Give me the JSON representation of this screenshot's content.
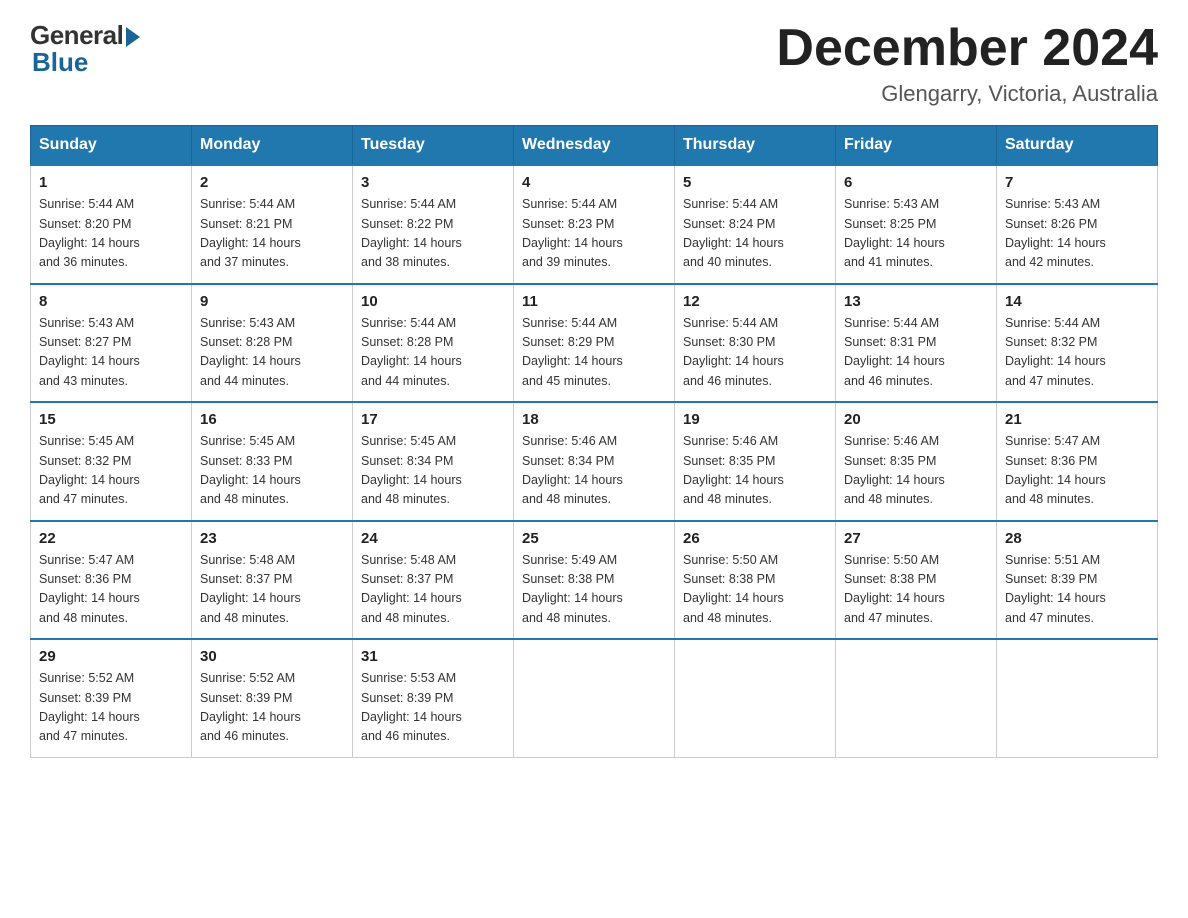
{
  "header": {
    "logo_general": "General",
    "logo_blue": "Blue",
    "month_title": "December 2024",
    "location": "Glengarry, Victoria, Australia"
  },
  "days_of_week": [
    "Sunday",
    "Monday",
    "Tuesday",
    "Wednesday",
    "Thursday",
    "Friday",
    "Saturday"
  ],
  "weeks": [
    [
      {
        "num": "1",
        "sunrise": "5:44 AM",
        "sunset": "8:20 PM",
        "daylight": "14 hours and 36 minutes."
      },
      {
        "num": "2",
        "sunrise": "5:44 AM",
        "sunset": "8:21 PM",
        "daylight": "14 hours and 37 minutes."
      },
      {
        "num": "3",
        "sunrise": "5:44 AM",
        "sunset": "8:22 PM",
        "daylight": "14 hours and 38 minutes."
      },
      {
        "num": "4",
        "sunrise": "5:44 AM",
        "sunset": "8:23 PM",
        "daylight": "14 hours and 39 minutes."
      },
      {
        "num": "5",
        "sunrise": "5:44 AM",
        "sunset": "8:24 PM",
        "daylight": "14 hours and 40 minutes."
      },
      {
        "num": "6",
        "sunrise": "5:43 AM",
        "sunset": "8:25 PM",
        "daylight": "14 hours and 41 minutes."
      },
      {
        "num": "7",
        "sunrise": "5:43 AM",
        "sunset": "8:26 PM",
        "daylight": "14 hours and 42 minutes."
      }
    ],
    [
      {
        "num": "8",
        "sunrise": "5:43 AM",
        "sunset": "8:27 PM",
        "daylight": "14 hours and 43 minutes."
      },
      {
        "num": "9",
        "sunrise": "5:43 AM",
        "sunset": "8:28 PM",
        "daylight": "14 hours and 44 minutes."
      },
      {
        "num": "10",
        "sunrise": "5:44 AM",
        "sunset": "8:28 PM",
        "daylight": "14 hours and 44 minutes."
      },
      {
        "num": "11",
        "sunrise": "5:44 AM",
        "sunset": "8:29 PM",
        "daylight": "14 hours and 45 minutes."
      },
      {
        "num": "12",
        "sunrise": "5:44 AM",
        "sunset": "8:30 PM",
        "daylight": "14 hours and 46 minutes."
      },
      {
        "num": "13",
        "sunrise": "5:44 AM",
        "sunset": "8:31 PM",
        "daylight": "14 hours and 46 minutes."
      },
      {
        "num": "14",
        "sunrise": "5:44 AM",
        "sunset": "8:32 PM",
        "daylight": "14 hours and 47 minutes."
      }
    ],
    [
      {
        "num": "15",
        "sunrise": "5:45 AM",
        "sunset": "8:32 PM",
        "daylight": "14 hours and 47 minutes."
      },
      {
        "num": "16",
        "sunrise": "5:45 AM",
        "sunset": "8:33 PM",
        "daylight": "14 hours and 48 minutes."
      },
      {
        "num": "17",
        "sunrise": "5:45 AM",
        "sunset": "8:34 PM",
        "daylight": "14 hours and 48 minutes."
      },
      {
        "num": "18",
        "sunrise": "5:46 AM",
        "sunset": "8:34 PM",
        "daylight": "14 hours and 48 minutes."
      },
      {
        "num": "19",
        "sunrise": "5:46 AM",
        "sunset": "8:35 PM",
        "daylight": "14 hours and 48 minutes."
      },
      {
        "num": "20",
        "sunrise": "5:46 AM",
        "sunset": "8:35 PM",
        "daylight": "14 hours and 48 minutes."
      },
      {
        "num": "21",
        "sunrise": "5:47 AM",
        "sunset": "8:36 PM",
        "daylight": "14 hours and 48 minutes."
      }
    ],
    [
      {
        "num": "22",
        "sunrise": "5:47 AM",
        "sunset": "8:36 PM",
        "daylight": "14 hours and 48 minutes."
      },
      {
        "num": "23",
        "sunrise": "5:48 AM",
        "sunset": "8:37 PM",
        "daylight": "14 hours and 48 minutes."
      },
      {
        "num": "24",
        "sunrise": "5:48 AM",
        "sunset": "8:37 PM",
        "daylight": "14 hours and 48 minutes."
      },
      {
        "num": "25",
        "sunrise": "5:49 AM",
        "sunset": "8:38 PM",
        "daylight": "14 hours and 48 minutes."
      },
      {
        "num": "26",
        "sunrise": "5:50 AM",
        "sunset": "8:38 PM",
        "daylight": "14 hours and 48 minutes."
      },
      {
        "num": "27",
        "sunrise": "5:50 AM",
        "sunset": "8:38 PM",
        "daylight": "14 hours and 47 minutes."
      },
      {
        "num": "28",
        "sunrise": "5:51 AM",
        "sunset": "8:39 PM",
        "daylight": "14 hours and 47 minutes."
      }
    ],
    [
      {
        "num": "29",
        "sunrise": "5:52 AM",
        "sunset": "8:39 PM",
        "daylight": "14 hours and 47 minutes."
      },
      {
        "num": "30",
        "sunrise": "5:52 AM",
        "sunset": "8:39 PM",
        "daylight": "14 hours and 46 minutes."
      },
      {
        "num": "31",
        "sunrise": "5:53 AM",
        "sunset": "8:39 PM",
        "daylight": "14 hours and 46 minutes."
      },
      null,
      null,
      null,
      null
    ]
  ],
  "labels": {
    "sunrise": "Sunrise:",
    "sunset": "Sunset:",
    "daylight": "Daylight:"
  }
}
